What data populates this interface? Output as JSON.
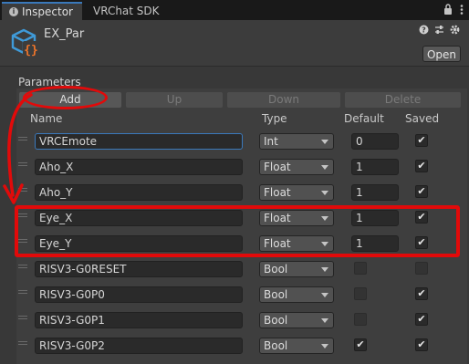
{
  "tabs": [
    {
      "label": "Inspector",
      "active": true
    },
    {
      "label": "VRChat SDK",
      "active": false
    }
  ],
  "tab_icons": [
    "lock-icon",
    "menu-icon"
  ],
  "header": {
    "asset_name": "EX_Par",
    "open_button": "Open",
    "icons": [
      "help-icon",
      "sliders-icon",
      "settings-icon"
    ]
  },
  "parameters": {
    "label": "Parameters",
    "toolbar": {
      "add": "Add",
      "up": "Up",
      "down": "Down",
      "delete": "Delete"
    },
    "columns": {
      "name": "Name",
      "type": "Type",
      "default": "Default",
      "saved": "Saved"
    },
    "rows": [
      {
        "name": "VRCEmote",
        "type": "Int",
        "default": "0",
        "saved": true
      },
      {
        "name": "Aho_X",
        "type": "Float",
        "default": "1",
        "saved": true
      },
      {
        "name": "Aho_Y",
        "type": "Float",
        "default": "1",
        "saved": true
      },
      {
        "name": "Eye_X",
        "type": "Float",
        "default": "1",
        "saved": true
      },
      {
        "name": "Eye_Y",
        "type": "Float",
        "default": "1",
        "saved": true
      },
      {
        "name": "RISV3-G0RESET",
        "type": "Bool",
        "default": false,
        "saved": false
      },
      {
        "name": "RISV3-G0P0",
        "type": "Bool",
        "default": false,
        "saved": true
      },
      {
        "name": "RISV3-G0P1",
        "type": "Bool",
        "default": false,
        "saved": true
      },
      {
        "name": "RISV3-G0P2",
        "type": "Bool",
        "default": true,
        "saved": true
      }
    ]
  },
  "colors": {
    "annotation": "#e20a0a",
    "focus": "#3a79bb",
    "background": "#383838"
  }
}
